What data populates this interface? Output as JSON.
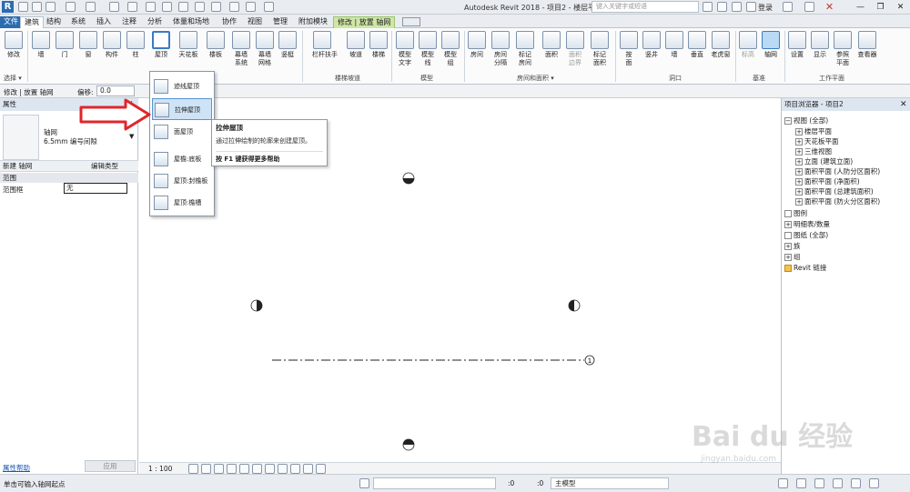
{
  "window": {
    "title": "Autodesk Revit 2018 -   项目2 - 楼层平面: 标高 1",
    "search_placeholder": "键入关键字或短语",
    "login": "登录"
  },
  "tabs": [
    "文件",
    "建筑",
    "结构",
    "系统",
    "插入",
    "注释",
    "分析",
    "体量和场地",
    "协作",
    "视图",
    "管理",
    "附加模块",
    "修改 | 放置 轴网"
  ],
  "ribbon": {
    "buttons": {
      "modify": "修改",
      "wall": "墙",
      "door": "门",
      "window": "窗",
      "component": "构件",
      "column": "柱",
      "roof": "屋顶",
      "ceiling": "天花板",
      "floor": "楼板",
      "curtain_system": "幕墙\n系统",
      "curtain_grid": "幕墙\n网格",
      "mullion": "竖梃",
      "railing": "栏杆扶手",
      "ramp": "坡道",
      "stair": "楼梯",
      "model_text": "模型\n文字",
      "model_line": "模型\n线",
      "model_group": "模型\n组",
      "room": "房间",
      "room_sep": "房间\n分隔",
      "tag_room": "标记\n房间",
      "area": "面积",
      "area_boundary": "面积\n边界",
      "tag_area": "标记\n面积",
      "by_face": "按\n面",
      "shaft": "竖井",
      "wall_open": "墙",
      "vertical": "垂直",
      "dormer": "老虎窗",
      "level": "标高",
      "grid": "轴网",
      "set": "设置",
      "show": "显示",
      "ref_plane": "参照\n平面",
      "viewer": "查看器"
    },
    "panels": {
      "select": "选择 ▾",
      "build": "构建",
      "circulation": "楼梯坡道",
      "model": "模型",
      "room_area": "房间和面积 ▾",
      "opening": "洞口",
      "datum": "基准",
      "work_plane": "工作平面"
    }
  },
  "options_bar": {
    "context": "修改 | 放置 轴网",
    "offset_label": "偏移:",
    "offset_value": "0.0"
  },
  "properties": {
    "title": "属性",
    "type_name": "轴网",
    "type_sub": "6.5mm 编号间隙",
    "new_label": "新建 轴网",
    "edit_type": "编辑类型",
    "group": "范围",
    "row_label": "范围框",
    "row_value": "无",
    "help": "属性帮助",
    "apply": "应用"
  },
  "roof_menu": {
    "items": [
      "迹线屋顶",
      "拉伸屋顶",
      "面屋顶",
      "屋檐:底板",
      "屋顶:封檐板",
      "屋顶:檐槽"
    ]
  },
  "tooltip": {
    "title": "拉伸屋顶",
    "desc": "通过拉伸绘制的轮廓来创建屋顶。",
    "help": "按 F1 键获得更多帮助"
  },
  "browser": {
    "title": "项目浏览器 - 项目2",
    "items": [
      "视图 (全部)",
      "楼层平面",
      "天花板平面",
      "三维视图",
      "立面 (建筑立面)",
      "面积平面 (人防分区面积)",
      "面积平面 (净面积)",
      "面积平面 (总建筑面积)",
      "面积平面 (防火分区面积)",
      "图例",
      "明细表/数量",
      "图纸 (全部)",
      "族",
      "组",
      "Revit 链接"
    ]
  },
  "canvas": {
    "scale": "1 : 100",
    "grid_bubble": "1"
  },
  "status": {
    "text": "单击可输入轴网起点",
    "zero1": ":0",
    "zero2": ":0",
    "model": "主模型"
  },
  "watermark": {
    "main": "Bai du 经验",
    "sub": "jingyan.baidu.com"
  }
}
